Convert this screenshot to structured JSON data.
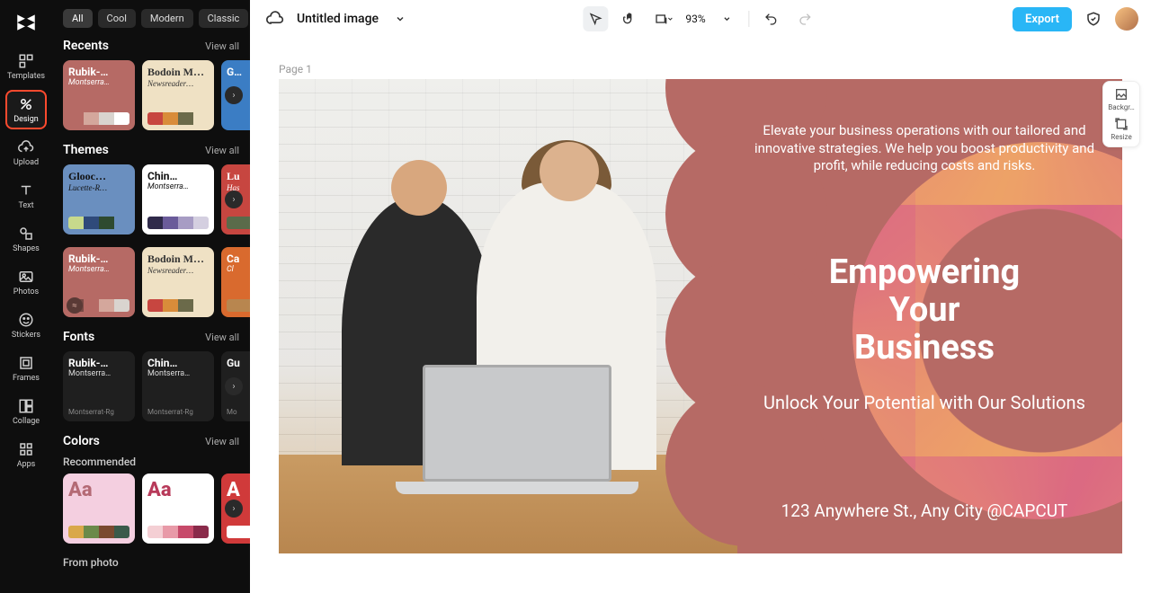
{
  "rail": {
    "items": [
      {
        "label": "Templates"
      },
      {
        "label": "Design"
      },
      {
        "label": "Upload"
      },
      {
        "label": "Text"
      },
      {
        "label": "Shapes"
      },
      {
        "label": "Photos"
      },
      {
        "label": "Stickers"
      },
      {
        "label": "Frames"
      },
      {
        "label": "Collage"
      },
      {
        "label": "Apps"
      }
    ]
  },
  "filters": {
    "chips": [
      "All",
      "Cool",
      "Modern",
      "Classic"
    ]
  },
  "sections": {
    "recents": {
      "title": "Recents",
      "view": "View all"
    },
    "themes": {
      "title": "Themes",
      "view": "View all"
    },
    "fonts": {
      "title": "Fonts",
      "view": "View all"
    },
    "colors": {
      "title": "Colors",
      "view": "View all"
    },
    "recommended": "Recommended",
    "from_photo": "From photo"
  },
  "recents_cards": [
    {
      "title": "Rubik-…",
      "sub": "Montserra…",
      "c": [
        "#b66a65",
        "#d4a79c",
        "#d9d4cf",
        "#ffffff"
      ],
      "bg": "#b66a65",
      "fg": "#fff"
    },
    {
      "title": "Bodoin Mo…",
      "sub": "Newsreader…",
      "c": [
        "#c74640",
        "#d98c3a",
        "#6b6a4a",
        "#efe1c4"
      ],
      "bg": "#efe1c4",
      "fg": "#333",
      "serif": true
    },
    {
      "title": "G…",
      "sub": "",
      "c": [
        "#3b7dc4"
      ],
      "bg": "#3b7dc4",
      "fg": "#fff"
    }
  ],
  "themes_row1": [
    {
      "title": "Glooc…",
      "sub": "Lucette-R…",
      "c": [
        "#c7d98c",
        "#2f4a7a",
        "#2e4a30",
        "#6a8fbf"
      ],
      "bg": "#6a8fbf",
      "fg": "#111",
      "serif": true
    },
    {
      "title": "Chin…",
      "sub": "Montserra…",
      "c": [
        "#2f2a4a",
        "#6a5b9a",
        "#a79cc4",
        "#d4cfe0"
      ],
      "bg": "#fff",
      "fg": "#111"
    },
    {
      "title": "Lu",
      "sub": "Has",
      "c": [
        "#5a6b4a",
        "#7a4a3a"
      ],
      "bg": "#c74640",
      "fg": "#fff",
      "serif": true
    }
  ],
  "themes_row2": [
    {
      "title": "Rubik-…",
      "sub": "Montserra…",
      "c": [
        "#7a4a45",
        "#b66a65",
        "#d4a79c",
        "#d9d4cf"
      ],
      "bg": "#b66a65",
      "fg": "#fff"
    },
    {
      "title": "Bodoin Mo…",
      "sub": "Newsreader…",
      "c": [
        "#c74640",
        "#d98c3a",
        "#6b6a4a",
        "#efe1c4"
      ],
      "bg": "#efe1c4",
      "fg": "#333",
      "serif": true
    },
    {
      "title": "Ca",
      "sub": "Cl",
      "c": [
        "#b8864f"
      ],
      "bg": "#d96a2e",
      "fg": "#fff"
    }
  ],
  "fonts_cards": [
    {
      "title": "Rubik-…",
      "sub": "Montserra…",
      "tag": "Montserrat-Rg"
    },
    {
      "title": "Chin…",
      "sub": "Montserra…",
      "tag": "Montserrat-Rg"
    },
    {
      "title": "Gu",
      "sub": "",
      "tag": "Mo"
    }
  ],
  "colors_cards": [
    {
      "aa": "Aa",
      "aa_color": "#b46a75",
      "bg": "#f4cfe0",
      "c": [
        "#d9a84a",
        "#6b8a4a",
        "#7a4a30",
        "#3a5a4a"
      ]
    },
    {
      "aa": "Aa",
      "aa_color": "#b83a5a",
      "bg": "#fff",
      "c": [
        "#f4cfd4",
        "#e89aa8",
        "#c74a6a",
        "#8a2a4a"
      ]
    },
    {
      "aa": "A",
      "aa_color": "#fff",
      "bg": "#d03a3a",
      "c": [
        "#fff"
      ]
    }
  ],
  "topbar": {
    "title": "Untitled image",
    "zoom": "93%",
    "export": "Export"
  },
  "side_tools": [
    {
      "label": "Backgr…"
    },
    {
      "label": "Resize"
    }
  ],
  "page": {
    "label": "Page 1"
  },
  "artboard": {
    "body": "Elevate your business operations with our tailored and innovative strategies. We help you boost productivity and profit, while reducing costs and risks.",
    "head_l1": "Empowering",
    "head_l2": "Your",
    "head_l3": "Business",
    "sub": "Unlock Your Potential with Our Solutions",
    "addr": "123 Anywhere St., Any City @CAPCUT"
  }
}
